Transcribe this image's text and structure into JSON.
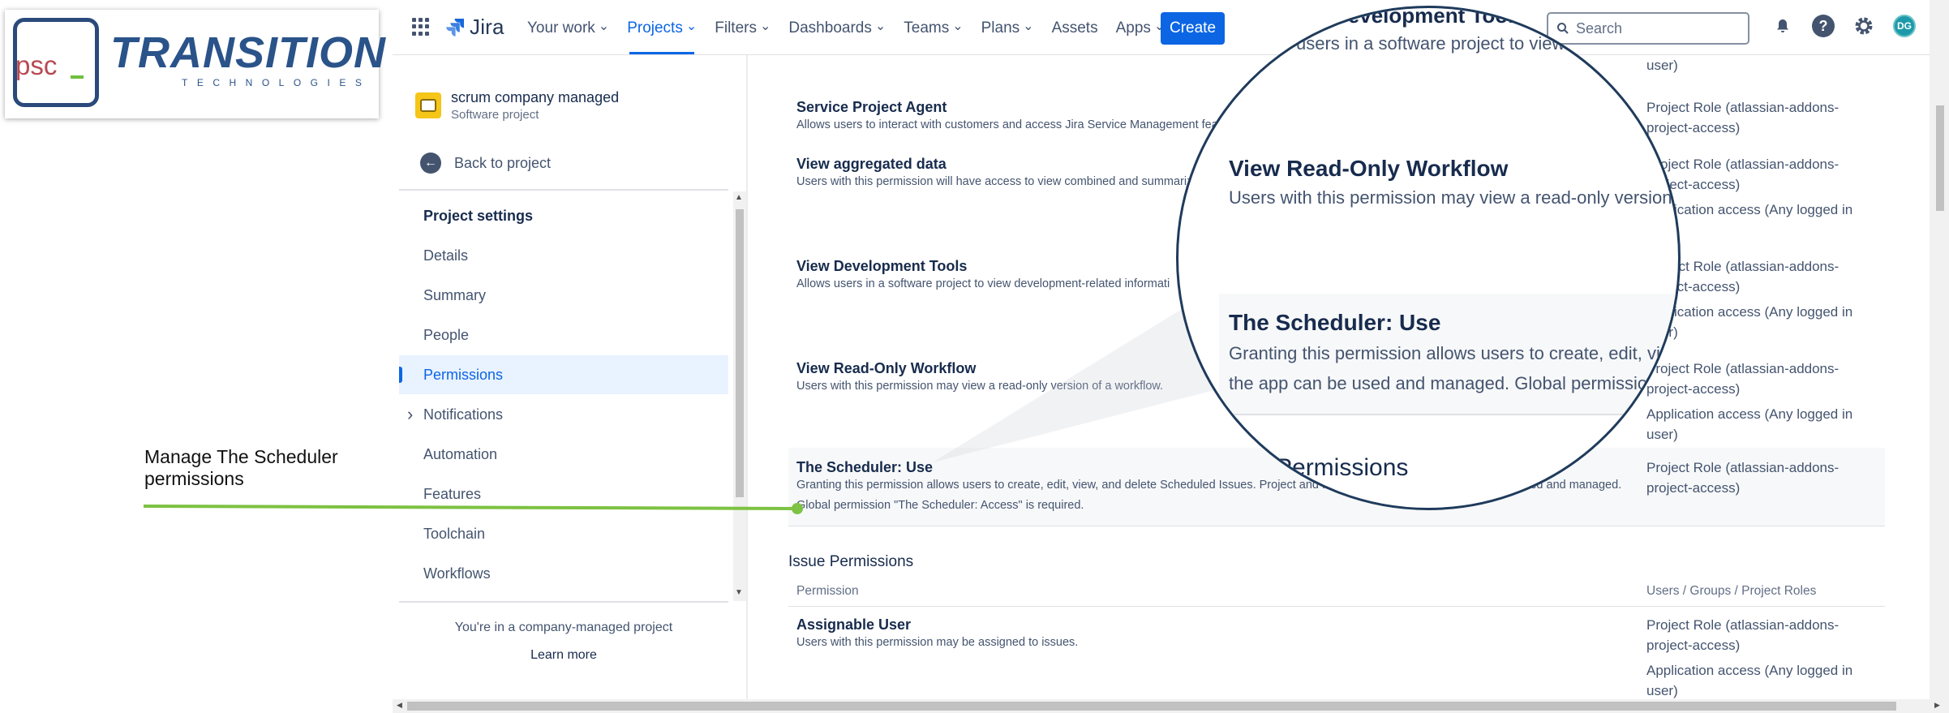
{
  "topnav": {
    "product": "Jira",
    "items": [
      {
        "label": "Your work",
        "chevron": true
      },
      {
        "label": "Projects",
        "chevron": true,
        "active": true
      },
      {
        "label": "Filters",
        "chevron": true
      },
      {
        "label": "Dashboards",
        "chevron": true
      },
      {
        "label": "Teams",
        "chevron": true
      },
      {
        "label": "Plans",
        "chevron": true
      },
      {
        "label": "Assets",
        "chevron": false
      },
      {
        "label": "Apps",
        "chevron": true
      }
    ],
    "create_label": "Create",
    "search_placeholder": "Search",
    "avatar_initials": "DG",
    "accent": "#0c66e4"
  },
  "sidebar": {
    "project_name": "scrum company managed",
    "project_type": "Software project",
    "back_label": "Back to project",
    "menu": [
      {
        "label": "Project settings",
        "kind": "title"
      },
      {
        "label": "Details"
      },
      {
        "label": "Summary"
      },
      {
        "label": "People"
      },
      {
        "label": "Permissions",
        "active": true
      },
      {
        "label": "Notifications",
        "expandable": true
      },
      {
        "label": "Automation"
      },
      {
        "label": "Features"
      },
      {
        "label": "Toolchain"
      },
      {
        "label": "Workflows"
      }
    ],
    "footer_text": "You're in a company-managed project",
    "learn_more": "Learn more"
  },
  "permissions": [
    {
      "name": "Service Project Agent",
      "desc": "Allows users to interact with customers and access Jira Service Management feat",
      "grants": [
        "Project Role (atlassian-addons-project-access)"
      ]
    },
    {
      "name": "View aggregated data",
      "desc": "Users with this permission will have access to view combined and summariz",
      "grants": [
        "Project Role (atlassian-addons-project-access)",
        "Application access (Any logged in user)"
      ]
    },
    {
      "name": "View Development Tools",
      "desc": "Allows users in a software project to view development-related informati",
      "grants": [
        "Project Role (atlassian-addons-project-access)",
        "Application access (Any logged in user)"
      ]
    },
    {
      "name": "View Read-Only Workflow",
      "desc": "Users with this permission may view a read-only version of a workflow.",
      "grants": [
        "Project Role (atlassian-addons-project-access)",
        "Application access (Any logged in user)"
      ]
    },
    {
      "name": "The Scheduler: Use",
      "desc": "Granting this permission allows users to create, edit, view, and delete Scheduled Issues. Project and ...udit - to ensure that the app can be used and managed. Global permission \"The Scheduler: Access\" is required.",
      "grants": [
        "Project Role (atlassian-addons-project-access)"
      ],
      "highlight": true
    }
  ],
  "top_partial_grant": "user)",
  "issue_section": {
    "title": "Issue Permissions",
    "col_permission": "Permission",
    "col_roles": "Users / Groups / Project Roles",
    "rows": [
      {
        "name": "Assignable User",
        "desc": "Users with this permission may be assigned to issues.",
        "grants": [
          "Project Role (atlassian-addons-project-access)",
          "Application access (Any logged in user)"
        ]
      }
    ]
  },
  "annotation": {
    "text": "Manage The Scheduler permissions",
    "line_color": "#7dc242"
  },
  "logo": {
    "psc": "psc",
    "word": "TRANSITION",
    "sub": "TECHNOLOGIES",
    "brand_color": "#2a5389",
    "psc_color": "#b84a52"
  },
  "magnifier": {
    "top_heading": "Development Tools",
    "top_desc": "users in a software project to view d",
    "row1_name": "View Read-Only Workflow",
    "row1_desc": "Users with this permission may view a read-only version o",
    "row2_name": "The Scheduler: Use",
    "row2_desc1": "Granting this permission allows users to create, edit, view",
    "row2_desc2": "the app can be used and managed. Global permission",
    "section": "Permissions"
  }
}
